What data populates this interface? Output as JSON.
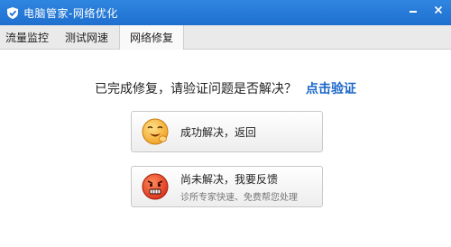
{
  "window": {
    "title": "电脑管家-网络优化",
    "minimize_icon": "minimize-icon",
    "close_icon": "close-icon",
    "titlebar_color": "#1f6fcf"
  },
  "tabs": [
    {
      "label": "流量监控",
      "active": false
    },
    {
      "label": "测试网速",
      "active": false
    },
    {
      "label": "网络修复",
      "active": true
    }
  ],
  "main": {
    "question": "已完成修复，请验证问题是否解决？",
    "verify_link": "点击验证",
    "link_color": "#1a66c8"
  },
  "options": [
    {
      "label": "成功解决，返回",
      "sublabel": "",
      "icon": "happy-face-icon"
    },
    {
      "label": "尚未解决，我要反馈",
      "sublabel": "诊所专家快速、免费帮您处理",
      "icon": "angry-face-icon"
    }
  ]
}
